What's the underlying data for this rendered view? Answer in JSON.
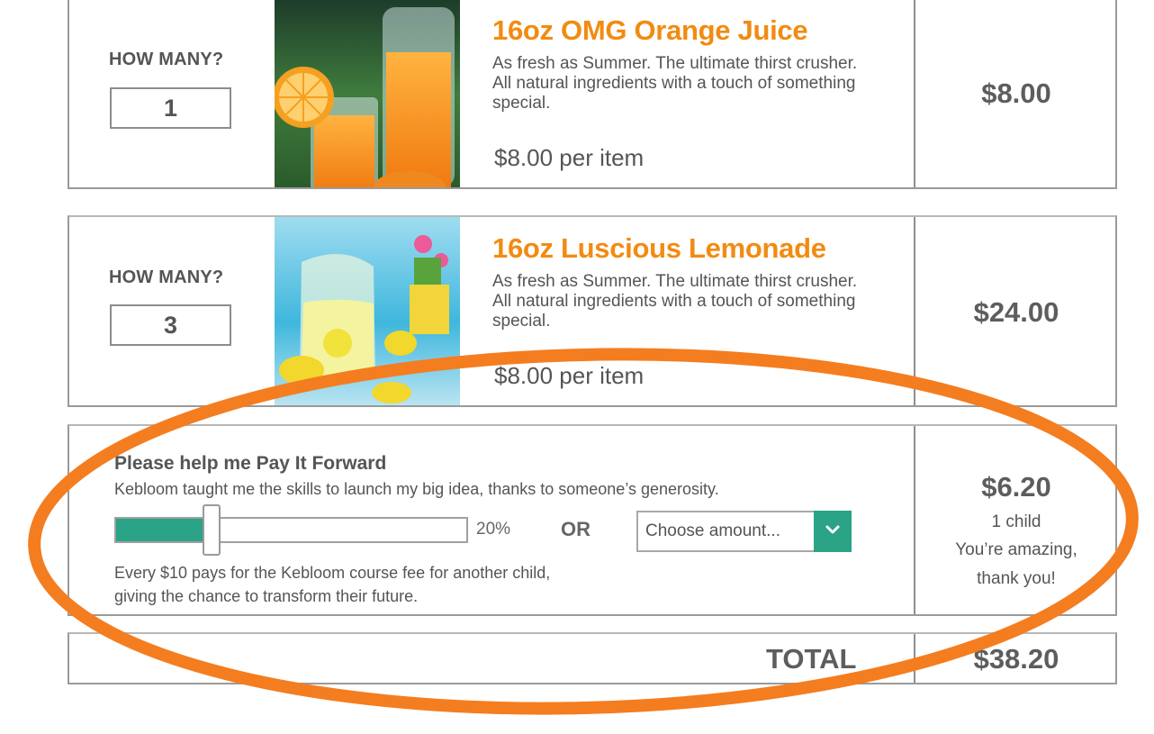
{
  "cart": {
    "items": [
      {
        "qty_label": "HOW MANY?",
        "qty_value": "1",
        "name": "16oz OMG Orange Juice",
        "description": "As fresh as Summer. The ultimate thirst crusher. All natural ingredients with a touch of something special.",
        "per_item": "$8.00 per item",
        "line_total": "$8.00"
      },
      {
        "qty_label": "HOW MANY?",
        "qty_value": "3",
        "name": "16oz Luscious Lemonade",
        "description": "As fresh as Summer. The ultimate thirst crusher. All natural ingredients with a touch of something special.",
        "per_item": "$8.00 per item",
        "line_total": "$24.00"
      }
    ],
    "pay_it_forward": {
      "title": "Please help me Pay It Forward",
      "subtitle": "Kebloom taught me the skills to launch my big idea, thanks to someone’s generosity.",
      "slider_percent": 20,
      "slider_label": "20%",
      "or_label": "OR",
      "select_placeholder": "Choose amount...",
      "note_line1": "Every $10 pays for the Kebloom course fee for another child,",
      "note_line2": "giving the chance to transform their future.",
      "amount": "$6.20",
      "children": "1 child",
      "thanks_line1": "You’re amazing,",
      "thanks_line2": "thank you!"
    },
    "total_label": "TOTAL",
    "total_value": "$38.20"
  },
  "colors": {
    "accent_orange": "#f28b12",
    "accent_green": "#2aa386",
    "annotation_ring": "#f47d20"
  },
  "icons": {
    "select_toggle": "chevron-down-icon"
  }
}
